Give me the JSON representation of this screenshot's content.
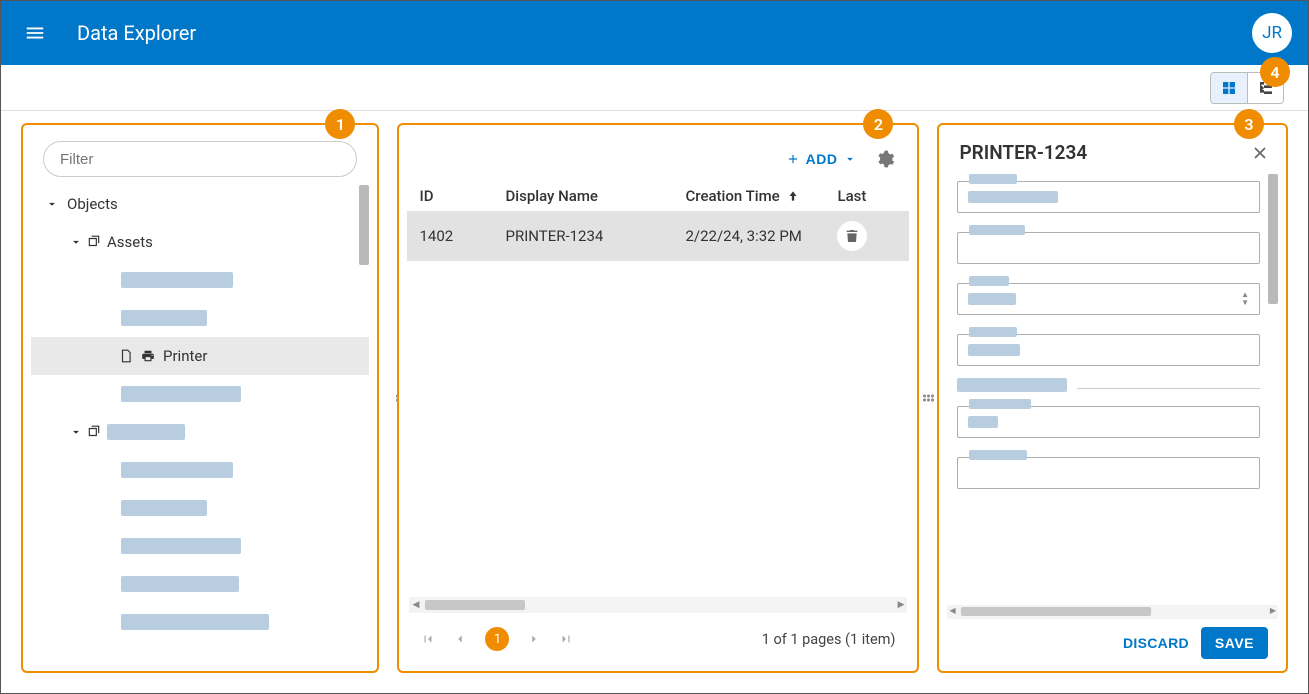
{
  "header": {
    "title": "Data Explorer",
    "user_initials": "JR"
  },
  "view_switch": {
    "active": "grid"
  },
  "panel_badges": [
    "1",
    "2",
    "3",
    "4"
  ],
  "tree": {
    "filter_placeholder": "Filter",
    "root_label": "Objects",
    "group_label": "Assets",
    "selected_item": "Printer"
  },
  "table": {
    "add_label": "ADD",
    "columns": [
      "ID",
      "Display Name",
      "Creation Time",
      "Last"
    ],
    "sort_column": "Creation Time",
    "sort_direction": "asc",
    "rows": [
      {
        "id": "1402",
        "name": "PRINTER-1234",
        "time": "2/22/24, 3:32 PM"
      }
    ],
    "pager": {
      "current": "1",
      "summary": "1 of 1 pages (1 item)"
    }
  },
  "details": {
    "title": "PRINTER-1234",
    "discard_label": "DISCARD",
    "save_label": "SAVE"
  }
}
